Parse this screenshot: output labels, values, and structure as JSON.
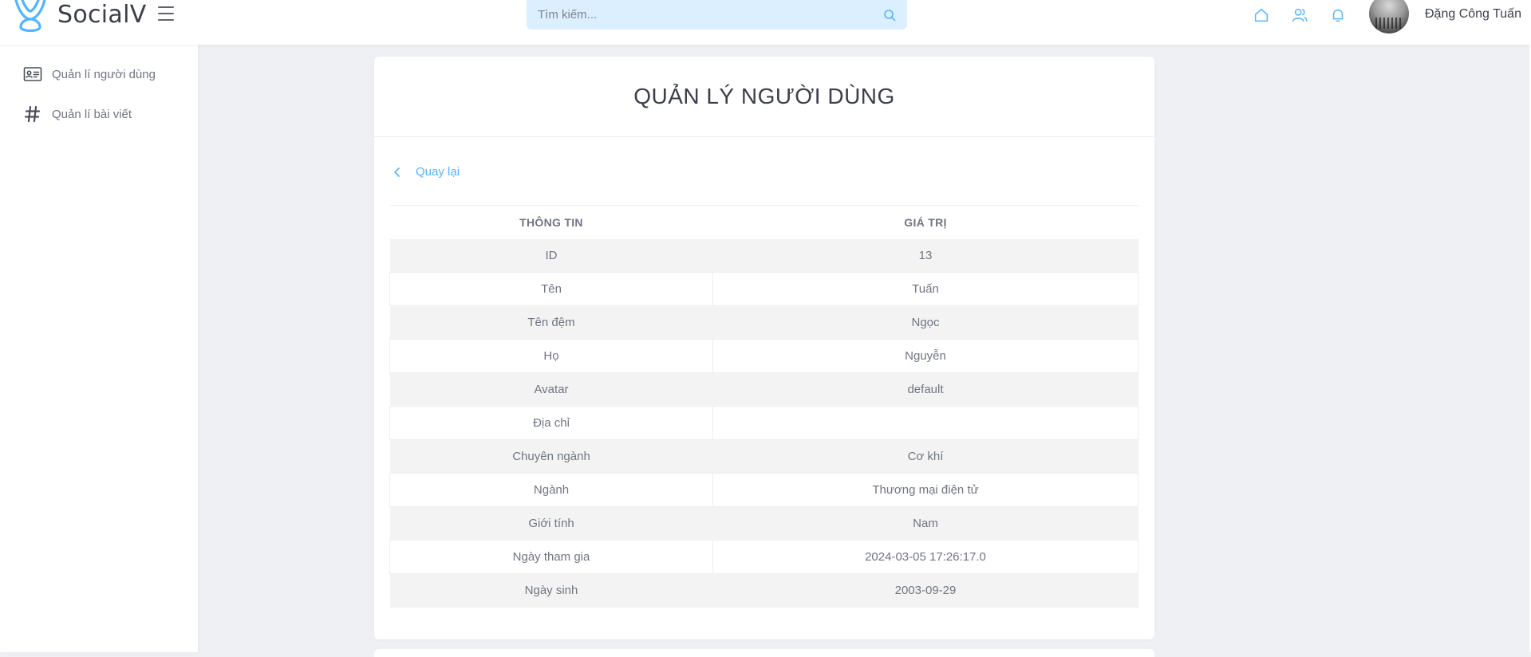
{
  "brand": {
    "name": "SocialV"
  },
  "colors": {
    "accent": "#50b5ff",
    "search_bg": "#dcefff",
    "text": "#6f7582",
    "heading": "#3a3f4a"
  },
  "search": {
    "placeholder": "Tìm kiếm..."
  },
  "header": {
    "icons": [
      "home-icon",
      "friends-icon",
      "bell-icon"
    ],
    "user_name": "Đặng Công Tuấn"
  },
  "sidebar": {
    "items": [
      {
        "label": "Quản lí người dùng",
        "icon": "id-card-icon"
      },
      {
        "label": "Quản lí bài viết",
        "icon": "hashtag-icon"
      }
    ]
  },
  "main": {
    "title": "QUẢN LÝ NGƯỜI DÙNG",
    "back_label": "Quay lại",
    "table": {
      "headers": [
        "THÔNG TIN",
        "GIÁ TRỊ"
      ],
      "rows": [
        [
          "ID",
          "13"
        ],
        [
          "Tên",
          "Tuấn"
        ],
        [
          "Tên đệm",
          "Ngọc"
        ],
        [
          "Họ",
          "Nguyễn"
        ],
        [
          "Avatar",
          "default"
        ],
        [
          "Địa chỉ",
          ""
        ],
        [
          "Chuyên ngành",
          "Cơ khí"
        ],
        [
          "Ngành",
          "Thương mại điện tử"
        ],
        [
          "Giới tính",
          "Nam"
        ],
        [
          "Ngày tham gia",
          "2024-03-05 17:26:17.0"
        ],
        [
          "Ngày sinh",
          "2003-09-29"
        ]
      ]
    }
  }
}
